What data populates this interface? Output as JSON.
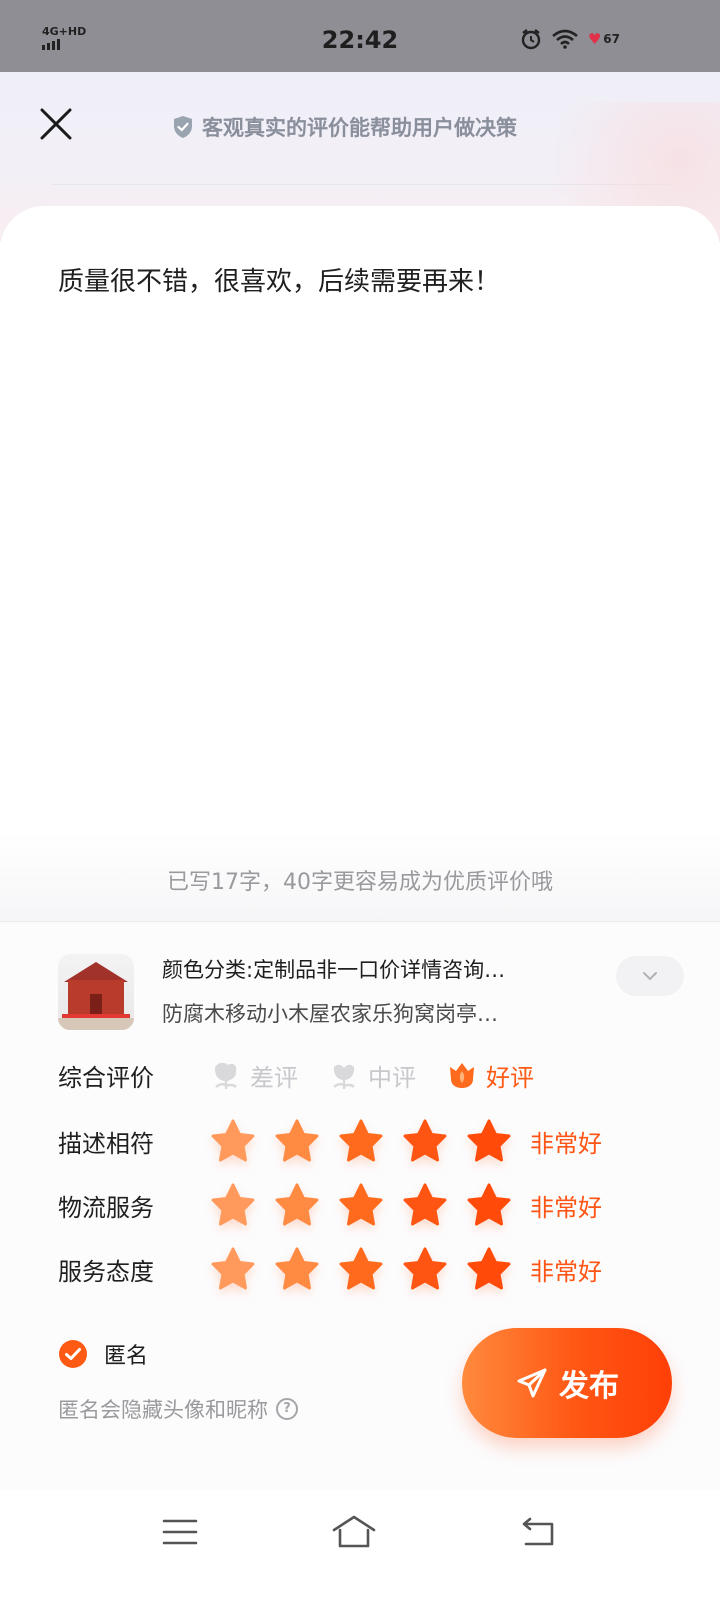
{
  "status_bar": {
    "network": "4G+HD",
    "time": "22:42",
    "battery": "67",
    "icons": [
      "signal-icon",
      "alarm-icon",
      "wifi-icon",
      "battery-heart-icon"
    ]
  },
  "header": {
    "notice": "客观真实的评价能帮助用户做决策",
    "icons": [
      "close-icon",
      "verified-shield-icon"
    ]
  },
  "review": {
    "text": "质量很不错，很喜欢，后续需要再来！",
    "hint": "已写17字，40字更容易成为优质评价哦"
  },
  "product": {
    "spec": "颜色分类:定制品非一口价详情咨询…",
    "name": "防腐木移动小木屋农家乐狗窝岗亭…",
    "icons": [
      "product-thumbnail",
      "chevron-down-icon"
    ]
  },
  "ratings": {
    "overall": {
      "label": "综合评价",
      "options": [
        {
          "label": "差评",
          "selected": false
        },
        {
          "label": "中评",
          "selected": false
        },
        {
          "label": "好评",
          "selected": true
        }
      ]
    },
    "rows": [
      {
        "label": "描述相符",
        "stars": 5,
        "text": "非常好"
      },
      {
        "label": "物流服务",
        "stars": 5,
        "text": "非常好"
      },
      {
        "label": "服务态度",
        "stars": 5,
        "text": "非常好"
      }
    ],
    "star_colors": [
      "#ff9a5c",
      "#ff8a42",
      "#ff6a1c",
      "#ff5512",
      "#ff4a0a"
    ],
    "accent": "#ff5a14"
  },
  "anonymous": {
    "label": "匿名",
    "checked": true,
    "desc": "匿名会隐藏头像和昵称",
    "help": "?"
  },
  "publish": {
    "label": "发布",
    "icon": "send-icon"
  },
  "nav": {
    "icons": [
      "menu-icon",
      "home-icon",
      "back-icon"
    ]
  }
}
